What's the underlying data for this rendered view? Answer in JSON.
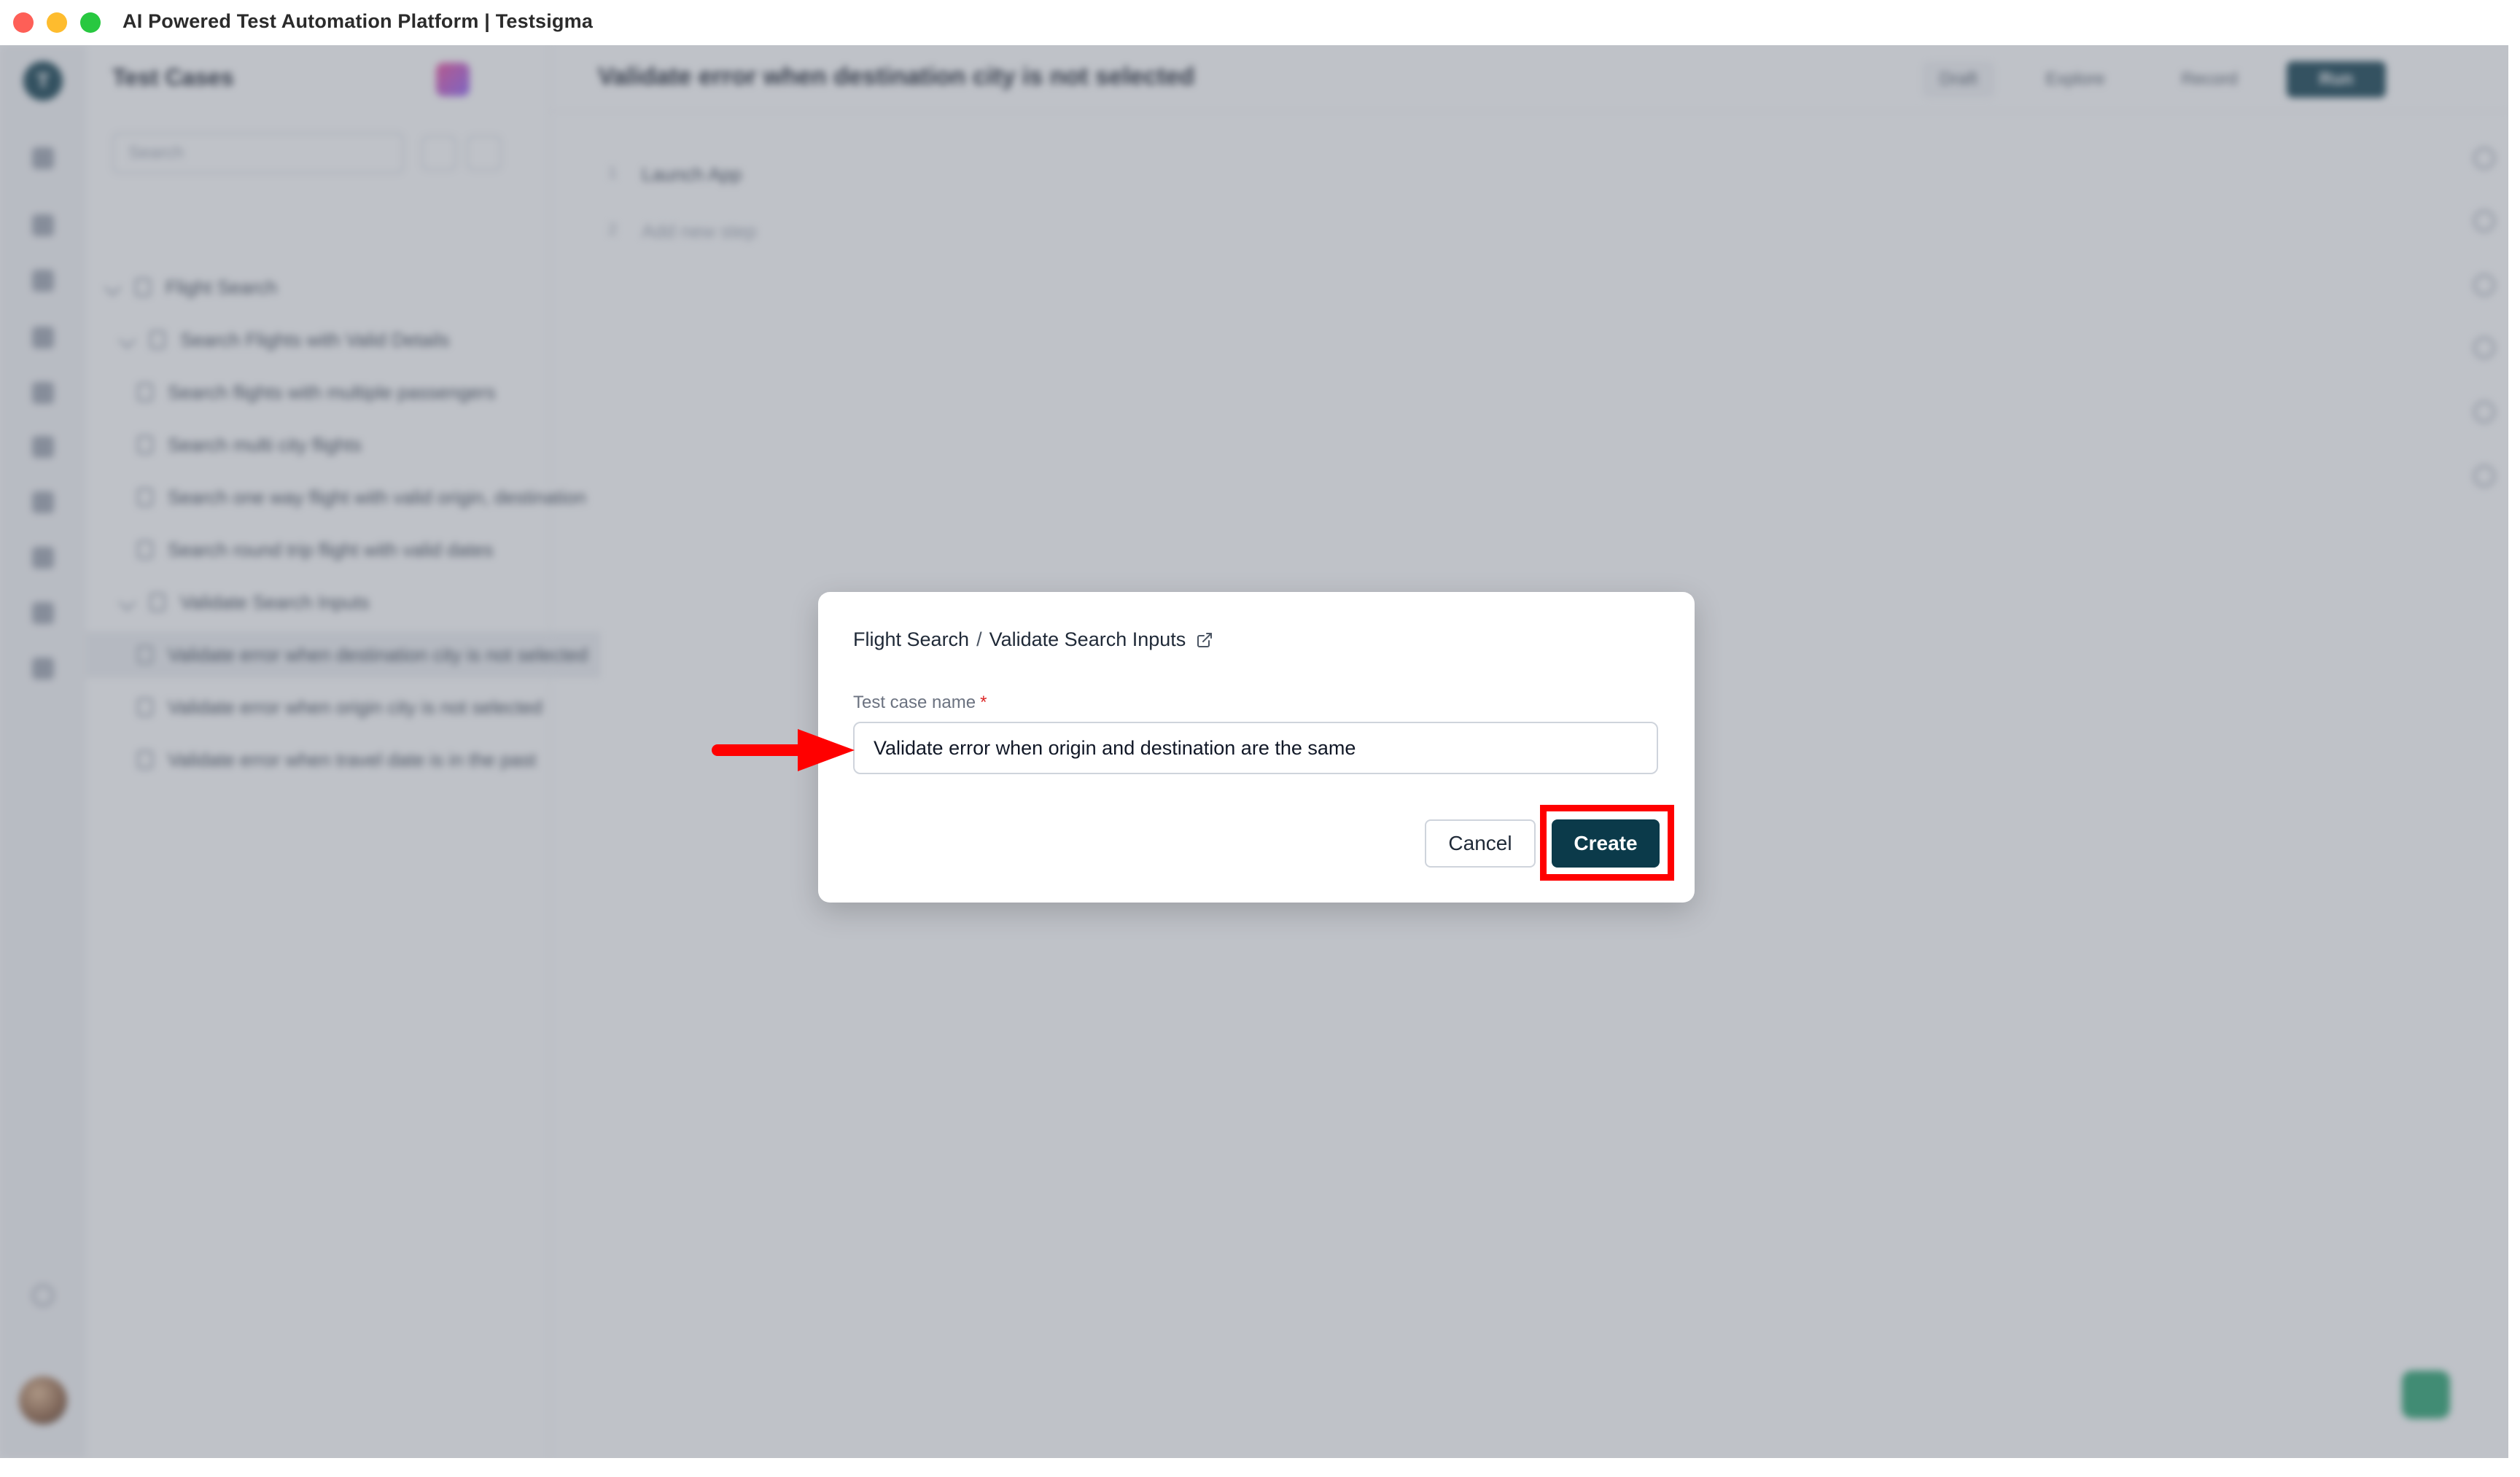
{
  "window": {
    "title": "AI Powered Test Automation Platform | Testsigma"
  },
  "background": {
    "rail_logo": "T",
    "panel_title": "Test Cases",
    "search_placeholder": "Search",
    "tree": [
      {
        "label": "Flight Search",
        "level": 0
      },
      {
        "label": "Search Flights with Valid Details",
        "level": 1
      },
      {
        "label": "Search flights with multiple passengers",
        "level": 2
      },
      {
        "label": "Search multi city flights",
        "level": 2
      },
      {
        "label": "Search one way flight with valid origin, destination",
        "level": 2
      },
      {
        "label": "Search round trip flight with valid dates",
        "level": 2
      },
      {
        "label": "Validate Search Inputs",
        "level": 1
      },
      {
        "label": "Validate error when destination city is not selected",
        "level": 2,
        "selected": true
      },
      {
        "label": "Validate error when origin city is not selected",
        "level": 2
      },
      {
        "label": "Validate error when travel date is in the past",
        "level": 2
      }
    ],
    "main_title": "Validate error when destination city is not selected",
    "header_actions": {
      "draft": "Draft",
      "explore": "Explore",
      "record": "Record",
      "run": "Run"
    },
    "steps": [
      {
        "number": "1",
        "label": "Launch App"
      },
      {
        "number": "2",
        "label": "Add new step"
      }
    ]
  },
  "modal": {
    "breadcrumb": {
      "parent": "Flight Search",
      "separator": "/",
      "child": "Validate Search Inputs",
      "icon": "external-link-icon"
    },
    "field": {
      "label": "Test case name",
      "required_marker": "*",
      "value": "Validate error when origin and destination are the same"
    },
    "buttons": {
      "cancel": "Cancel",
      "create": "Create"
    }
  },
  "annotations": {
    "color": "#ff0000",
    "highlight_target": "create-button",
    "arrow_target": "test-case-name-input"
  },
  "colors": {
    "primary": "#0b3a4a",
    "required": "#dc2626",
    "overlay": "rgba(107,114,128,0.43)"
  }
}
